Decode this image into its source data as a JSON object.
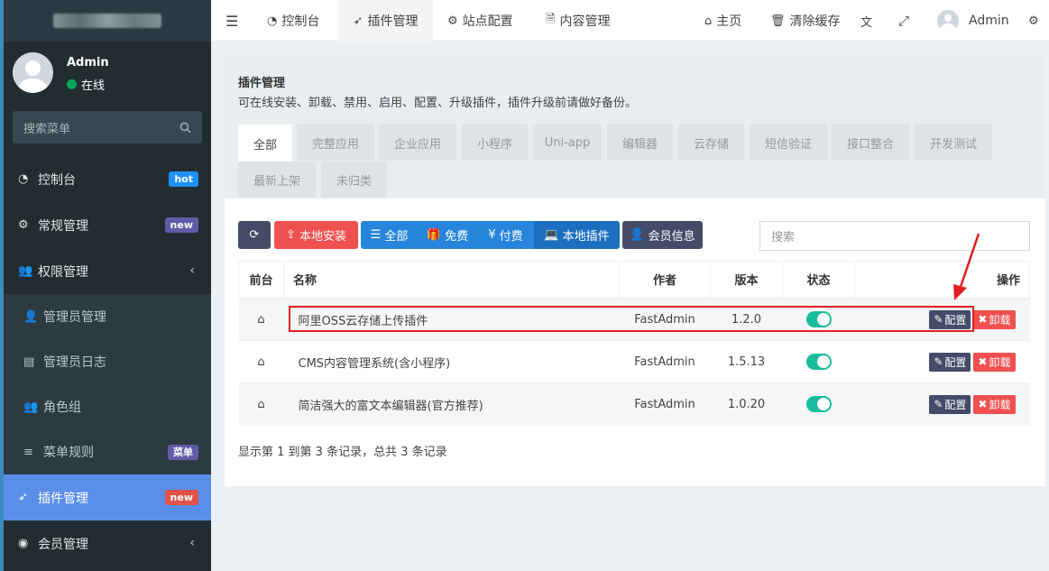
{
  "sidebar": {
    "user": {
      "name": "Admin",
      "status": "在线"
    },
    "search_placeholder": "搜索菜单",
    "items": [
      {
        "label": "控制台",
        "icon": "dashboard-icon",
        "badge": "hot"
      },
      {
        "label": "常规管理",
        "icon": "cogs-icon",
        "badge": "new"
      },
      {
        "label": "权限管理",
        "icon": "users-icon"
      },
      {
        "label": "管理员管理",
        "icon": "user-icon"
      },
      {
        "label": "管理员日志",
        "icon": "list-alt-icon"
      },
      {
        "label": "角色组",
        "icon": "group-icon"
      },
      {
        "label": "菜单规则",
        "icon": "bars-icon",
        "badge": "菜单"
      },
      {
        "label": "插件管理",
        "icon": "rocket-icon",
        "badge": "new"
      },
      {
        "label": "会员管理",
        "icon": "user-circle-icon"
      }
    ]
  },
  "topbar": {
    "tabs": [
      {
        "label": "控制台",
        "icon": "dashboard-icon"
      },
      {
        "label": "插件管理",
        "icon": "rocket-icon"
      },
      {
        "label": "站点配置",
        "icon": "cogs-icon"
      },
      {
        "label": "内容管理",
        "icon": "file-icon"
      }
    ],
    "home": "主页",
    "clear_cache": "清除缓存",
    "user": "Admin"
  },
  "panel": {
    "title": "插件管理",
    "description": "可在线安装、卸载、禁用、启用、配置、升级插件，插件升级前请做好备份。",
    "category_tabs": [
      "全部",
      "完整应用",
      "企业应用",
      "小程序",
      "Uni-app",
      "编辑器",
      "云存储",
      "短信验证",
      "接口整合",
      "开发测试",
      "最新上架",
      "未归类"
    ],
    "toolbar": {
      "local_install": "本地安装",
      "all": "全部",
      "free": "免费",
      "paid": "付费",
      "local_plugins": "本地插件",
      "member_info": "会员信息",
      "search_placeholder": "搜索"
    },
    "table": {
      "headers": {
        "frontend": "前台",
        "name": "名称",
        "author": "作者",
        "version": "版本",
        "status": "状态",
        "actions": "操作"
      },
      "rows": [
        {
          "name": "阿里OSS云存储上传插件",
          "author": "FastAdmin",
          "version": "1.2.0",
          "enabled": true
        },
        {
          "name": "CMS内容管理系统(含小程序)",
          "author": "FastAdmin",
          "version": "1.5.13",
          "enabled": true
        },
        {
          "name": "简洁强大的富文本编辑器(官方推荐)",
          "author": "FastAdmin",
          "version": "1.0.20",
          "enabled": true
        }
      ],
      "config_label": "配置",
      "uninstall_label": "卸载"
    },
    "footer": "显示第 1 到第 3 条记录，总共 3 条记录"
  }
}
